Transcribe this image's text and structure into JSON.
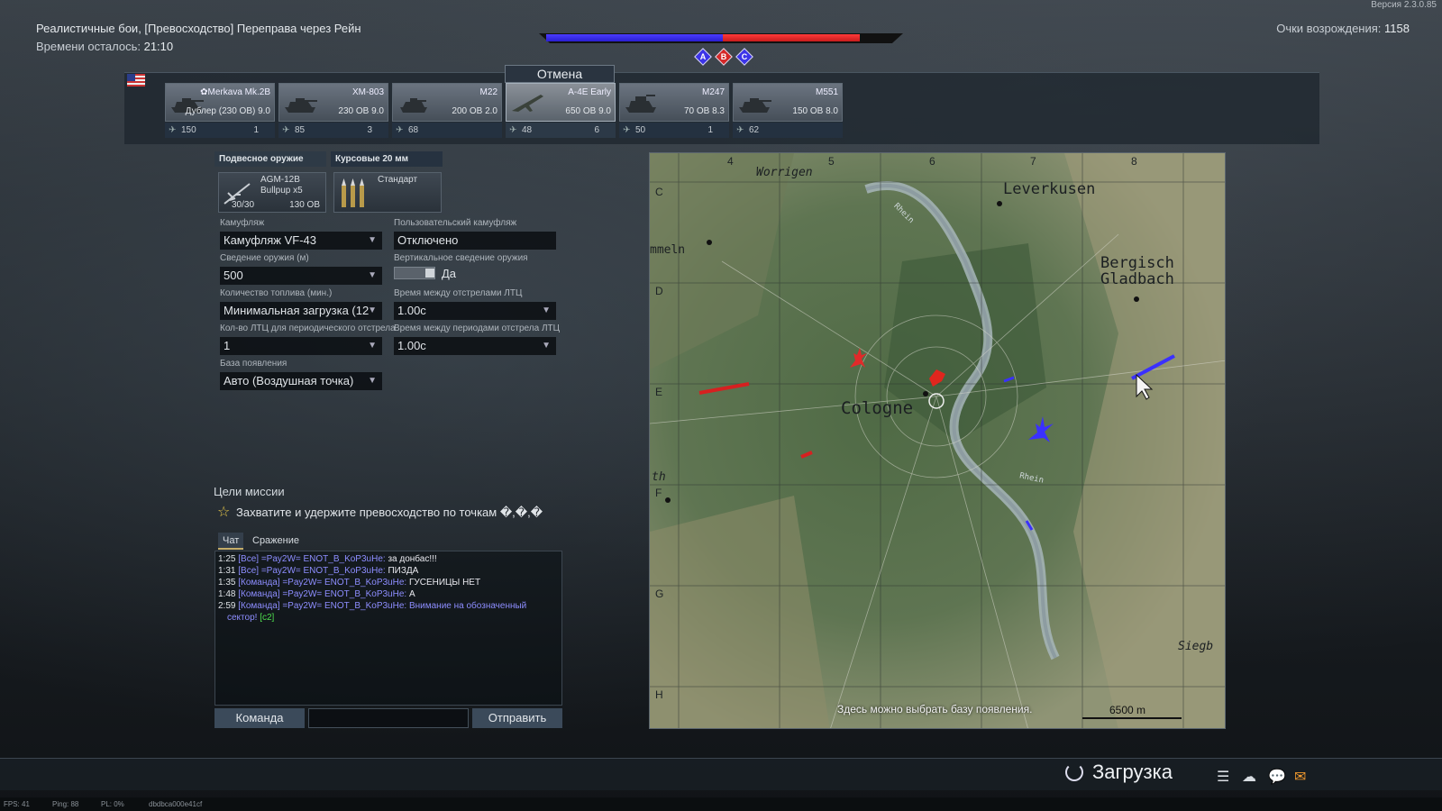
{
  "version": "Версия 2.3.0.85",
  "header": {
    "battle_title": "Реалистичные бои, [Превосходство] Переправа через Рейн",
    "time_left_label": "Времени осталось:",
    "time_left_value": "21:10",
    "respawn_label": "Очки возрождения:",
    "respawn_value": "1158"
  },
  "zones": [
    "A",
    "B",
    "C"
  ],
  "cancel_label": "Отмена",
  "units": [
    {
      "name": "✿Merkava Mk.2B",
      "br": "Дублер (230 ОВ) 9.0",
      "count": "1",
      "cost": "150"
    },
    {
      "name": "XM-803",
      "br": "230 ОВ 9.0",
      "count": "3",
      "cost": "85"
    },
    {
      "name": "M22",
      "br": "200 ОВ 2.0",
      "count": "",
      "cost": "68"
    },
    {
      "name": "A-4E Early",
      "br": "650 ОВ 9.0",
      "count": "6",
      "cost": "48"
    },
    {
      "name": "M247",
      "br": "70 ОВ 8.3",
      "count": "1",
      "cost": "50"
    },
    {
      "name": "M551",
      "br": "150 ОВ 8.0",
      "count": "",
      "cost": "62"
    }
  ],
  "weapons": {
    "tab_suspended": "Подвесное оружие",
    "tab_guns": "Курсовые 20 мм",
    "missile_name": "AGM-12B Bullpup x5",
    "missile_ammo": "30/30",
    "missile_cost": "130 ОВ",
    "ammo_name": "Стандарт"
  },
  "form": {
    "camo_label": "Камуфляж",
    "camo_value": "Камуфляж VF-43",
    "custom_camo_label": "Пользовательский камуфляж",
    "custom_camo_value": "Отключено",
    "convergence_label": "Сведение оружия (м)",
    "convergence_value": "500",
    "vert_conv_label": "Вертикальное сведение оружия",
    "vert_conv_value": "Да",
    "fuel_label": "Количество топлива (мин.)",
    "fuel_value": "Минимальная загрузка (12",
    "tracer_time_label": "Время между отстрелами ЛТЦ",
    "tracer_time_value": "1.00с",
    "tracer_count_label": "Кол-во ЛТЦ для периодического отстрела",
    "tracer_count_value": "1",
    "tracer_period_label": "Время между периодами отстрела ЛТЦ",
    "tracer_period_value": "1.00с",
    "spawn_label": "База появления",
    "spawn_value": "Авто (Воздушная точка)"
  },
  "mission": {
    "title": "Цели миссии",
    "objective": "Захватите и удержите превосходство по точкам �,�,�"
  },
  "chat": {
    "tab_chat": "Чат",
    "tab_battle": "Сражение",
    "lines": [
      {
        "time": "1:25",
        "channel": "[Все] =Pay2W= ENOT_B_KoP3uHe:",
        "msg": "за донбас!!!",
        "blue": false
      },
      {
        "time": "1:31",
        "channel": "[Все] =Pay2W= ENOT_B_KoP3uHe:",
        "msg": "ПИЗДА",
        "blue": false
      },
      {
        "time": "1:35",
        "channel": "[Команда] =Pay2W= ENOT_B_KoP3uHe:",
        "msg": "ГУСЕНИЦЫ НЕТ",
        "blue": false
      },
      {
        "time": "1:48",
        "channel": "[Команда] =Pay2W= ENOT_B_KoP3uHe:",
        "msg": "А",
        "blue": false
      },
      {
        "time": "2:59",
        "channel": "[Команда] =Pay2W= ENOT_B_KoP3uHe:",
        "msg": "Внимание на обозначенный",
        "blue": true
      }
    ],
    "cont_text": "сектор!",
    "cont_grid": "[c2]",
    "team_button": "Команда",
    "send_button": "Отправить"
  },
  "map": {
    "cols": [
      "4",
      "5",
      "6",
      "7",
      "8"
    ],
    "rows": [
      "C",
      "D",
      "E",
      "F",
      "G",
      "H"
    ],
    "cities": {
      "worringen": "Worrigen",
      "leverkusen": "Leverkusen",
      "bergisch1": "Bergisch",
      "bergisch2": "Gladbach",
      "cologne": "Cologne",
      "dormagen": "mmeln",
      "siegb": "Siegb",
      "west": "th",
      "rhein1": "Rhein",
      "rhein2": "Rhein"
    },
    "hint": "Здесь можно выбрать базу появления.",
    "scale": "6500 m"
  },
  "bottom": {
    "loading": "Загрузка",
    "fps": "FPS: 41",
    "ping": "Ping: 88",
    "pl": "PL: 0%",
    "hash": "dbdbca000e41cf"
  },
  "colors": {
    "blue_team": "#3c34e8",
    "red_team": "#d52828",
    "mail": "#f29a2e",
    "chat_channel": "#8d8dff",
    "chat_grid": "#4ede4e"
  }
}
